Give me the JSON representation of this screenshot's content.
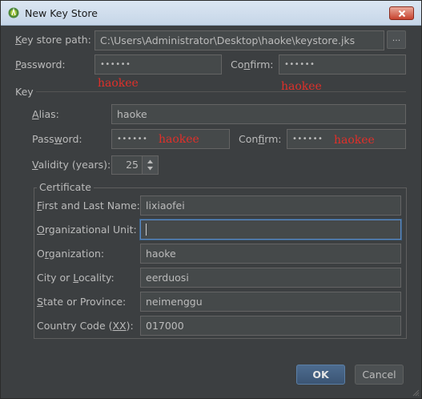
{
  "window": {
    "title": "New Key Store"
  },
  "keystore": {
    "path_label_pre": "",
    "path_label_key": "K",
    "path_label_post": "ey store path:",
    "path_value": "C:\\Users\\Administrator\\Desktop\\haoke\\keystore.jks",
    "browse_label": "...",
    "password_label_pre": "",
    "password_label_key": "P",
    "password_label_post": "assword:",
    "password_value": "••••••",
    "confirm_label_pre": "Co",
    "confirm_label_key": "n",
    "confirm_label_post": "firm:",
    "confirm_value": "••••••",
    "annotation_password": "haokee",
    "annotation_confirm": "haokee"
  },
  "key": {
    "group_label": "Key",
    "alias_label_pre": "",
    "alias_label_key": "A",
    "alias_label_post": "lias:",
    "alias_value": "haoke",
    "password_label_pre": "Pass",
    "password_label_key": "w",
    "password_label_post": "ord:",
    "password_value": "••••••",
    "confirm_label_pre": "Con",
    "confirm_label_key": "f",
    "confirm_label_post": "irm:",
    "confirm_value": "••••••",
    "annotation_password": "haokee",
    "annotation_confirm": "haokee",
    "validity_label_pre": "",
    "validity_label_key": "V",
    "validity_label_post": "alidity (years):",
    "validity_value": "25"
  },
  "certificate": {
    "group_label": "Certificate",
    "first_last_label_pre": "",
    "first_last_label_key": "F",
    "first_last_label_post": "irst and Last Name:",
    "first_last_value": "lixiaofei",
    "org_unit_label_pre": "",
    "org_unit_label_key": "O",
    "org_unit_label_post": "rganizational Unit:",
    "org_unit_value": "",
    "org_label_pre": "O",
    "org_label_key": "r",
    "org_label_post": "ganization:",
    "org_value": "haoke",
    "city_label_pre": "City or ",
    "city_label_key": "L",
    "city_label_post": "ocality:",
    "city_value": "eerduosi",
    "state_label_pre": "",
    "state_label_key": "S",
    "state_label_post": "tate or Province:",
    "state_value": "neimenggu",
    "country_label_pre": "Country Code (",
    "country_label_key": "XX",
    "country_label_post": "):",
    "country_value": "017000"
  },
  "buttons": {
    "ok": "OK",
    "cancel": "Cancel"
  }
}
